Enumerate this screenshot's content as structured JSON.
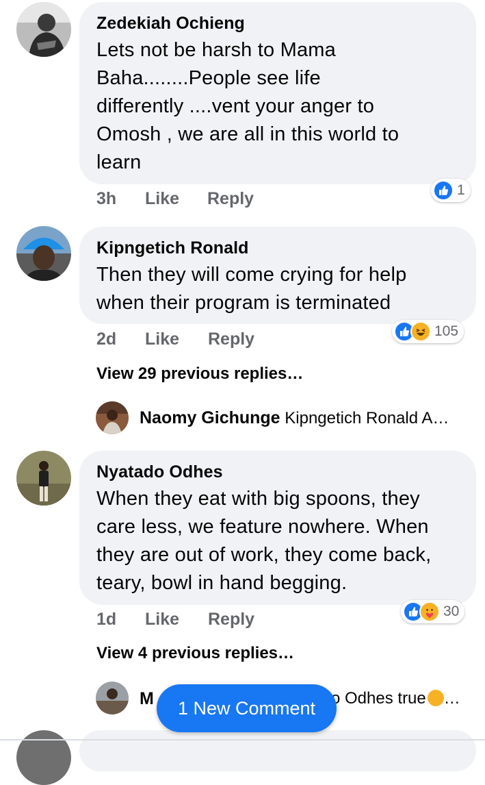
{
  "comments": [
    {
      "author": "Zedekiah Ochieng",
      "lines": [
        "Lets not be harsh to Mama",
        "Baha........People see life",
        "differently ....vent your anger to",
        "Omosh , we are all in this world to",
        "learn"
      ],
      "time": "3h",
      "like_label": "Like",
      "reply_label": "Reply",
      "reactions": [
        "like-icon"
      ],
      "reaction_count": "1"
    },
    {
      "author": "Kipngetich Ronald",
      "lines": [
        "Then they will come crying for help",
        "when their program is terminated"
      ],
      "time": "2d",
      "like_label": "Like",
      "reply_label": "Reply",
      "reactions": [
        "like-icon",
        "haha-icon"
      ],
      "reaction_count": "105",
      "view_replies": "View 29 previous replies…",
      "latest_reply": {
        "author": "Naomy Gichunge",
        "text": "Kipngetich Ronald A…"
      }
    },
    {
      "author": "Nyatado Odhes",
      "lines": [
        "When they eat with big spoons, they",
        "care less, we feature nowhere. When",
        "they are out of work, they come back,",
        "teary, bowl in hand begging."
      ],
      "time": "1d",
      "like_label": "Like",
      "reply_label": "Reply",
      "reactions": [
        "like-icon",
        "care-icon"
      ],
      "reaction_count": "30",
      "view_replies": "View 4 previous replies…",
      "latest_reply": {
        "author_partial": "M",
        "text_partial": "o Odhes true",
        "ellipsis": "…"
      }
    }
  ],
  "new_comment_button": "1 New Comment",
  "colors": {
    "accent": "#1877f2",
    "bubble": "#f0f2f5",
    "meta": "#65676b",
    "haha": "#f7b125"
  }
}
